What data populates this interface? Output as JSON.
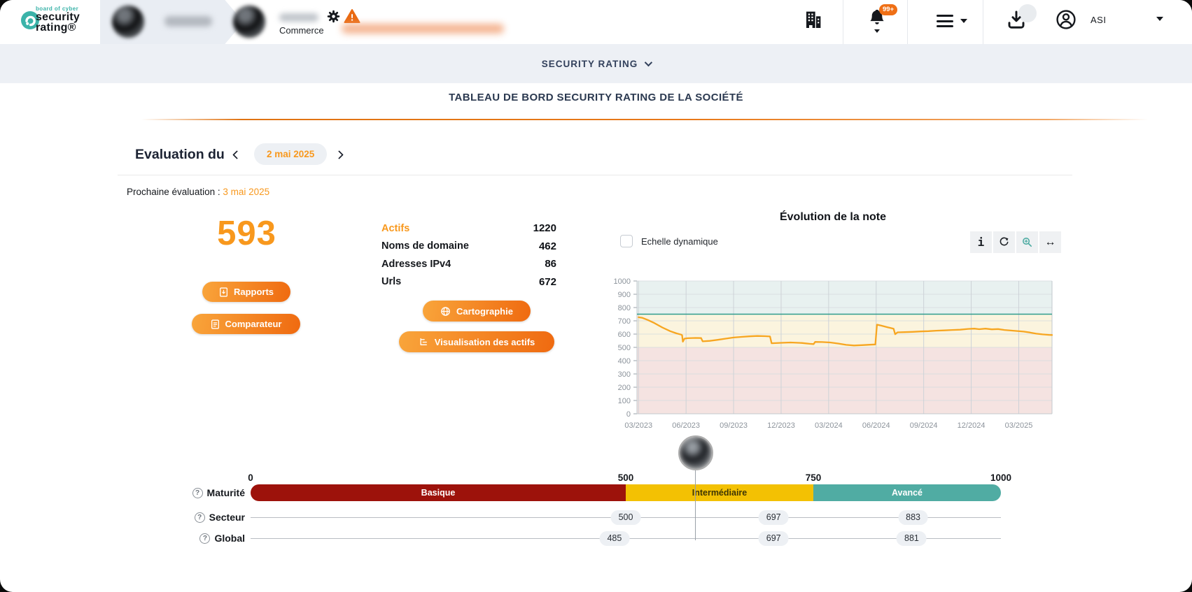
{
  "colors": {
    "accent_orange": "#F8981D",
    "button_gradient": [
      "#F9A53B",
      "#EF6A10"
    ],
    "brand_teal": "#3BB3A9",
    "navy_text": "#2B3950",
    "basic_red": "#9D120B",
    "intermediate_yellow": "#F3C103",
    "advanced_teal": "#50ACA3",
    "chart_line": "#F7A621",
    "threshold_teal": "#2E9C8E"
  },
  "header": {
    "logo": {
      "tagline": "board of cyber",
      "name_line1": "security",
      "name_line2": "rating®"
    },
    "org_category": "Commerce",
    "notifications_badge": "99+",
    "user_initials": "ASI"
  },
  "subnav": {
    "title": "SECURITY RATING"
  },
  "page": {
    "title": "TABLEAU DE BORD SECURITY RATING DE LA SOCIÉTÉ"
  },
  "evaluation": {
    "label": "Evaluation du",
    "date": "2 mai 2025",
    "next_label": "Prochaine évaluation :",
    "next_date": "3 mai 2025"
  },
  "score": {
    "value": "593"
  },
  "buttons": {
    "rapports": "Rapports",
    "comparateur": "Comparateur",
    "cartographie": "Cartographie",
    "visualisation": "Visualisation des actifs"
  },
  "assets": {
    "rows": [
      {
        "label": "Actifs",
        "value": "1220",
        "highlight": true
      },
      {
        "label": "Noms de domaine",
        "value": "462",
        "highlight": false
      },
      {
        "label": "Adresses IPv4",
        "value": "86",
        "highlight": false
      },
      {
        "label": "Urls",
        "value": "672",
        "highlight": false
      }
    ]
  },
  "chart": {
    "title": "Évolution de la note",
    "dynamic_scale_label": "Echelle dynamique",
    "toolbar": [
      {
        "name": "info",
        "glyph": "i"
      },
      {
        "name": "refresh",
        "glyph": ""
      },
      {
        "name": "zoom-in",
        "glyph": ""
      },
      {
        "name": "pan-horizontal",
        "glyph": "↔"
      }
    ]
  },
  "chart_data": {
    "type": "line",
    "title": "Évolution de la note",
    "ylim": [
      0,
      1000
    ],
    "y_ticks": [
      0,
      100,
      200,
      300,
      400,
      500,
      600,
      700,
      800,
      900,
      1000
    ],
    "x_domain": [
      -0.1,
      26.1
    ],
    "x_tick_months": [
      0,
      3,
      6,
      9,
      12,
      15,
      18,
      21,
      24
    ],
    "x_tick_labels": [
      "03/2023",
      "06/2023",
      "09/2023",
      "12/2023",
      "03/2024",
      "06/2024",
      "09/2024",
      "12/2024",
      "03/2025"
    ],
    "grid": true,
    "legend": "none",
    "bands": [
      {
        "from": 0,
        "to": 500,
        "color": "#F5E3E1"
      },
      {
        "from": 500,
        "to": 750,
        "color": "#FBF4DE"
      },
      {
        "from": 750,
        "to": 1000,
        "color": "#E8F1F0"
      }
    ],
    "threshold": {
      "value": 750,
      "color": "#2E9C8E"
    },
    "series": [
      {
        "name": "Note",
        "color": "#F7A621",
        "points": [
          [
            0,
            727
          ],
          [
            0.25,
            722
          ],
          [
            0.6,
            706
          ],
          [
            1.0,
            683
          ],
          [
            1.5,
            650
          ],
          [
            2.0,
            622
          ],
          [
            2.4,
            605
          ],
          [
            2.7,
            596
          ],
          [
            2.75,
            591
          ],
          [
            2.8,
            543
          ],
          [
            2.9,
            566
          ],
          [
            3.1,
            569
          ],
          [
            3.6,
            571
          ],
          [
            3.95,
            570
          ],
          [
            4.05,
            545
          ],
          [
            4.5,
            549
          ],
          [
            5.0,
            557
          ],
          [
            5.5,
            566
          ],
          [
            6.0,
            574
          ],
          [
            6.5,
            579
          ],
          [
            7.0,
            583
          ],
          [
            7.5,
            586
          ],
          [
            8.0,
            584
          ],
          [
            8.3,
            582
          ],
          [
            8.4,
            531
          ],
          [
            9.0,
            534
          ],
          [
            9.6,
            537
          ],
          [
            10.3,
            533
          ],
          [
            10.8,
            527
          ],
          [
            11.05,
            525
          ],
          [
            11.15,
            541
          ],
          [
            11.6,
            540
          ],
          [
            12.1,
            537
          ],
          [
            12.6,
            529
          ],
          [
            13.1,
            519
          ],
          [
            13.6,
            514
          ],
          [
            14.1,
            517
          ],
          [
            14.6,
            520
          ],
          [
            14.95,
            522
          ],
          [
            15.05,
            671
          ],
          [
            15.3,
            664
          ],
          [
            15.7,
            652
          ],
          [
            16.0,
            643
          ],
          [
            16.1,
            640
          ],
          [
            16.2,
            599
          ],
          [
            16.35,
            613
          ],
          [
            16.8,
            615
          ],
          [
            17.3,
            617
          ],
          [
            17.8,
            620
          ],
          [
            18.3,
            622
          ],
          [
            18.8,
            626
          ],
          [
            19.3,
            628
          ],
          [
            19.8,
            631
          ],
          [
            20.3,
            633
          ],
          [
            20.8,
            639
          ],
          [
            21.2,
            641
          ],
          [
            21.5,
            637
          ],
          [
            21.9,
            641
          ],
          [
            22.3,
            636
          ],
          [
            22.7,
            638
          ],
          [
            23.1,
            631
          ],
          [
            23.5,
            627
          ],
          [
            23.9,
            623
          ],
          [
            24.3,
            619
          ],
          [
            24.7,
            612
          ],
          [
            25.1,
            603
          ],
          [
            25.5,
            598
          ],
          [
            25.9,
            594
          ],
          [
            26.1,
            593
          ]
        ]
      }
    ]
  },
  "maturity": {
    "scale_labels": [
      "0",
      "500",
      "750",
      "1000"
    ],
    "scale_values": [
      0,
      500,
      750,
      1000
    ],
    "bar": {
      "label": "Maturité",
      "segments": [
        {
          "label": "Basique",
          "from": 0,
          "to": 500,
          "color": "#9D120B",
          "text": "#ffffff"
        },
        {
          "label": "Intermédiaire",
          "from": 500,
          "to": 750,
          "color": "#F3C103",
          "text": "#3F3604"
        },
        {
          "label": "Avancé",
          "from": 750,
          "to": 1000,
          "color": "#50ACA3",
          "text": "#ffffff"
        }
      ]
    },
    "marker_value": 593,
    "rows": [
      {
        "label": "Secteur",
        "values": [
          "500",
          "697",
          "883"
        ]
      },
      {
        "label": "Global",
        "values": [
          "485",
          "697",
          "881"
        ]
      }
    ]
  }
}
